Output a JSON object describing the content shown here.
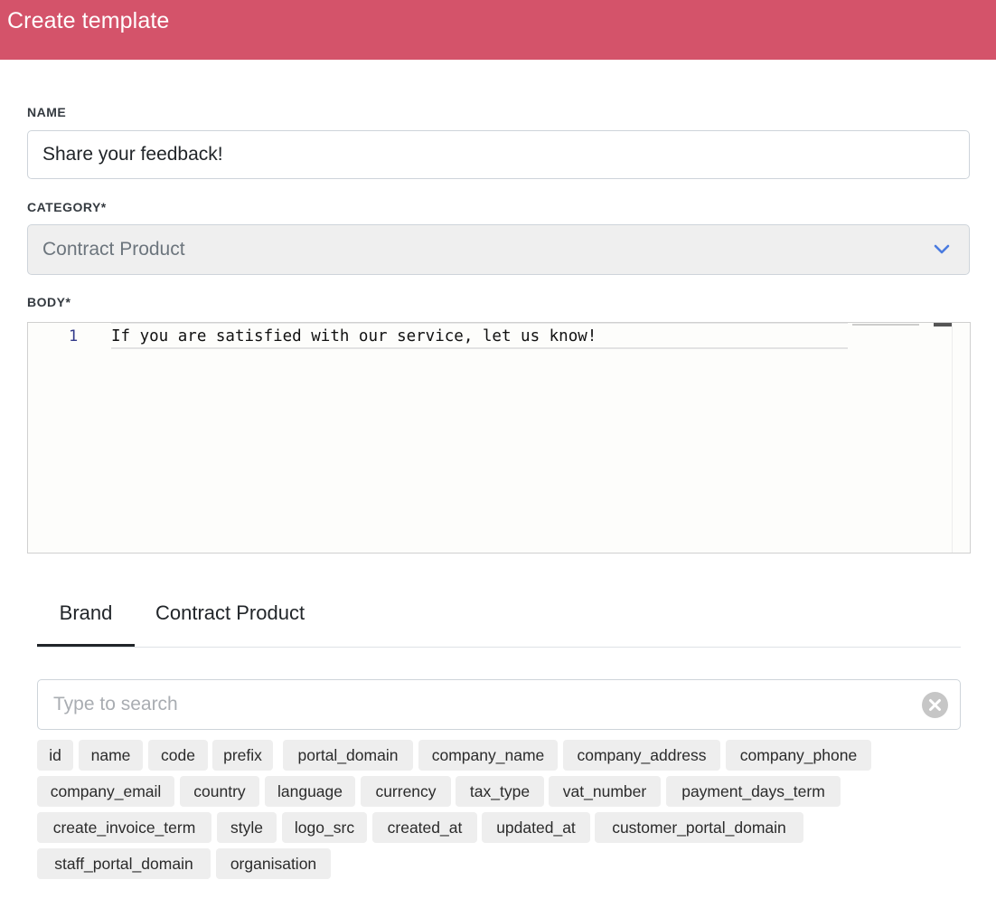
{
  "header": {
    "title": "Create template"
  },
  "form": {
    "name": {
      "label": "NAME",
      "value": "Share your feedback!"
    },
    "category": {
      "label": "CATEGORY*",
      "value": "Contract Product"
    },
    "body": {
      "label": "BODY*",
      "lines": [
        {
          "number": "1",
          "text": "If you are satisfied with our service, let us know!"
        }
      ]
    }
  },
  "tabs": [
    {
      "label": "Brand",
      "active": true
    },
    {
      "label": "Contract Product",
      "active": false
    }
  ],
  "search": {
    "placeholder": "Type to search",
    "value": ""
  },
  "variables": [
    "id",
    "name",
    "code",
    "prefix",
    "portal_domain",
    "company_name",
    "company_address",
    "company_phone",
    "company_email",
    "country",
    "language",
    "currency",
    "tax_type",
    "vat_number",
    "payment_days_term",
    "create_invoice_term",
    "style",
    "logo_src",
    "created_at",
    "updated_at",
    "customer_portal_domain",
    "staff_portal_domain",
    "organisation"
  ],
  "colors": {
    "header_bg": "#d4536a",
    "chevron": "#4a7be0",
    "active_tab": "#212529"
  }
}
